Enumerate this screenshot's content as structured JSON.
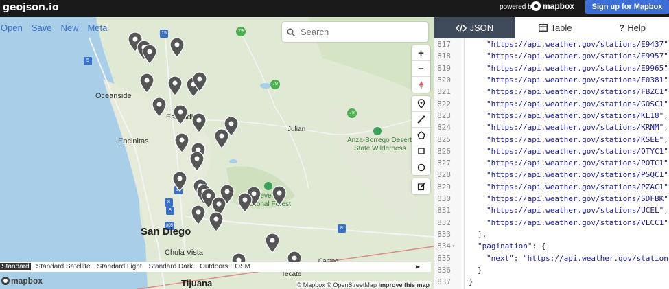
{
  "topbar": {
    "logo": "geojson.io",
    "powered_by": "powered by",
    "mapbox_label": "mapbox",
    "signup_label": "Sign up for Mapbox"
  },
  "map": {
    "menu": [
      "Open",
      "Save",
      "New",
      "Meta"
    ],
    "search_placeholder": "Search",
    "place_labels": [
      {
        "text": "Oceanside"
      },
      {
        "text": "Escondido"
      },
      {
        "text": "Encinitas"
      },
      {
        "text": "Julian"
      },
      {
        "text": "Anza-Borrego Desert"
      },
      {
        "text": "State Wilderness"
      },
      {
        "text": "Cleveland"
      },
      {
        "text": "National Forest"
      },
      {
        "text": "San Diego"
      },
      {
        "text": "Chula Vista"
      },
      {
        "text": "Campo"
      },
      {
        "text": "Tecate"
      },
      {
        "text": "Tijuana"
      }
    ],
    "road_shields": [
      "5",
      "15",
      "79",
      "79",
      "78",
      "8",
      "8",
      "805",
      "15",
      "8"
    ],
    "style_options": [
      "Standard",
      "Standard Satellite",
      "Standard Light",
      "Standard Dark",
      "Outdoors",
      "OSM"
    ],
    "selected_style": "Standard",
    "mapbox_logo": "mapbox",
    "attribution": "© Mapbox © OpenStreetMap",
    "improve": "Improve this map"
  },
  "panel": {
    "tabs": [
      {
        "label": "JSON",
        "icon": "code-icon",
        "active": true
      },
      {
        "label": "Table",
        "icon": "table-icon",
        "active": false
      },
      {
        "label": "Help",
        "icon": "help-icon",
        "active": false
      }
    ],
    "code_lines": [
      {
        "n": "817",
        "indent": 4,
        "text": "\"https://api.weather.gov/stations/E9437\","
      },
      {
        "n": "818",
        "indent": 4,
        "text": "\"https://api.weather.gov/stations/E9957\","
      },
      {
        "n": "819",
        "indent": 4,
        "text": "\"https://api.weather.gov/stations/E9965\","
      },
      {
        "n": "820",
        "indent": 4,
        "text": "\"https://api.weather.gov/stations/F0381\","
      },
      {
        "n": "821",
        "indent": 4,
        "text": "\"https://api.weather.gov/stations/FBZC1\","
      },
      {
        "n": "822",
        "indent": 4,
        "text": "\"https://api.weather.gov/stations/GOSC1\","
      },
      {
        "n": "823",
        "indent": 4,
        "text": "\"https://api.weather.gov/stations/KL18\","
      },
      {
        "n": "824",
        "indent": 4,
        "text": "\"https://api.weather.gov/stations/KRNM\","
      },
      {
        "n": "825",
        "indent": 4,
        "text": "\"https://api.weather.gov/stations/KSEE\","
      },
      {
        "n": "826",
        "indent": 4,
        "text": "\"https://api.weather.gov/stations/OTYC1\","
      },
      {
        "n": "827",
        "indent": 4,
        "text": "\"https://api.weather.gov/stations/POTC1\","
      },
      {
        "n": "828",
        "indent": 4,
        "text": "\"https://api.weather.gov/stations/PSQC1\","
      },
      {
        "n": "829",
        "indent": 4,
        "text": "\"https://api.weather.gov/stations/PZAC1\","
      },
      {
        "n": "830",
        "indent": 4,
        "text": "\"https://api.weather.gov/stations/SDFBK\","
      },
      {
        "n": "831",
        "indent": 4,
        "text": "\"https://api.weather.gov/stations/UCEL\","
      },
      {
        "n": "832",
        "indent": 4,
        "text": "\"https://api.weather.gov/stations/VLCC1\""
      },
      {
        "n": "833",
        "indent": 2,
        "text": "],"
      },
      {
        "n": "834",
        "indent": 2,
        "text": "\"pagination\": {",
        "fold": true
      },
      {
        "n": "835",
        "indent": 4,
        "text": "\"next\": \"https://api.weather.gov/stations?id="
      },
      {
        "n": "836",
        "indent": 2,
        "text": "}"
      },
      {
        "n": "837",
        "indent": 0,
        "text": "}"
      }
    ]
  },
  "colors": {
    "accent": "#3c6fd8",
    "tab_active": "#3f4a5a",
    "link": "#3a6fc7",
    "marker": "#555555"
  }
}
